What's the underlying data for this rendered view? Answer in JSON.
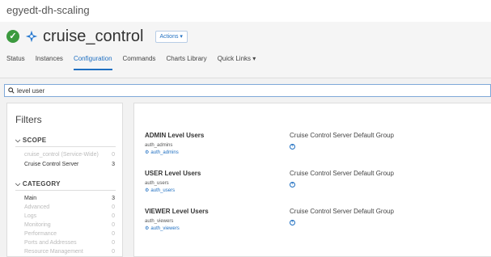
{
  "cluster": {
    "name": "egyedt-dh-scaling"
  },
  "service": {
    "name": "cruise_control",
    "actions_label": "Actions ▾"
  },
  "tabs": [
    {
      "label": "Status"
    },
    {
      "label": "Instances"
    },
    {
      "label": "Configuration"
    },
    {
      "label": "Commands"
    },
    {
      "label": "Charts Library"
    },
    {
      "label": "Quick Links ▾"
    }
  ],
  "search": {
    "value": "level user"
  },
  "filters": {
    "title": "Filters",
    "scope": {
      "heading": "SCOPE",
      "items": [
        {
          "label": "cruise_control (Service-Wide)",
          "count": "0"
        },
        {
          "label": "Cruise Control Server",
          "count": "3"
        }
      ]
    },
    "category": {
      "heading": "CATEGORY",
      "items": [
        {
          "label": "Main",
          "count": "3"
        },
        {
          "label": "Advanced",
          "count": "0"
        },
        {
          "label": "Logs",
          "count": "0"
        },
        {
          "label": "Monitoring",
          "count": "0"
        },
        {
          "label": "Performance",
          "count": "0"
        },
        {
          "label": "Ports and Addresses",
          "count": "0"
        },
        {
          "label": "Resource Management",
          "count": "0"
        }
      ]
    }
  },
  "properties": [
    {
      "title": "ADMIN Level Users",
      "key": "auth_admins",
      "link": "auth_admins",
      "group": "Cruise Control Server Default Group"
    },
    {
      "title": "USER Level Users",
      "key": "auth_users",
      "link": "auth_users",
      "group": "Cruise Control Server Default Group"
    },
    {
      "title": "VIEWER Level Users",
      "key": "auth_viewers",
      "link": "auth_viewers",
      "group": "Cruise Control Server Default Group"
    }
  ],
  "colors": {
    "accent": "#1f6fc1",
    "success": "#3c9a3f"
  },
  "icons": {
    "status": "check-circle-icon",
    "service": "cruise-control-icon",
    "search": "search-icon",
    "config": "gear-icon",
    "add": "plus-circle-icon"
  }
}
